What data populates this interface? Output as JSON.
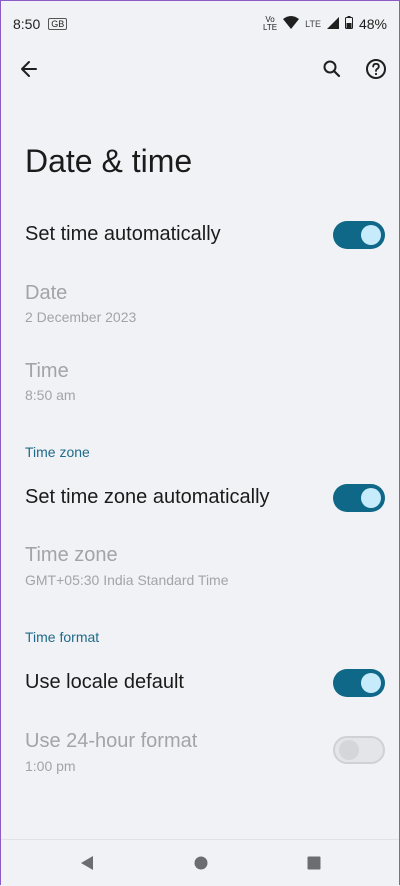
{
  "status_bar": {
    "time": "8:50",
    "gb_badge": "GB",
    "volte_top": "Vo",
    "volte_bottom": "LTE",
    "lte_label": "LTE",
    "battery": "48%"
  },
  "toolbar": {
    "back_icon": "arrow-back-icon",
    "search_icon": "search-icon",
    "help_icon": "help-icon"
  },
  "page": {
    "title": "Date & time"
  },
  "settings": {
    "set_time_auto": {
      "label": "Set time automatically",
      "enabled": true
    },
    "date": {
      "label": "Date",
      "value": "2 December 2023"
    },
    "time": {
      "label": "Time",
      "value": "8:50 am"
    },
    "timezone_section": "Time zone",
    "set_timezone_auto": {
      "label": "Set time zone automatically",
      "enabled": true
    },
    "timezone": {
      "label": "Time zone",
      "value": "GMT+05:30 India Standard Time"
    },
    "time_format_section": "Time format",
    "locale_default": {
      "label": "Use locale default",
      "enabled": true
    },
    "use_24h": {
      "label": "Use 24-hour format",
      "value": "1:00 pm",
      "enabled": false
    }
  },
  "colors": {
    "accent": "#0f6887",
    "section_header": "#1f6a8a",
    "background": "#f0f2f5"
  },
  "nav_bar": {
    "back_icon": "triangle-back-icon",
    "home_icon": "circle-home-icon",
    "recents_icon": "square-recents-icon"
  }
}
